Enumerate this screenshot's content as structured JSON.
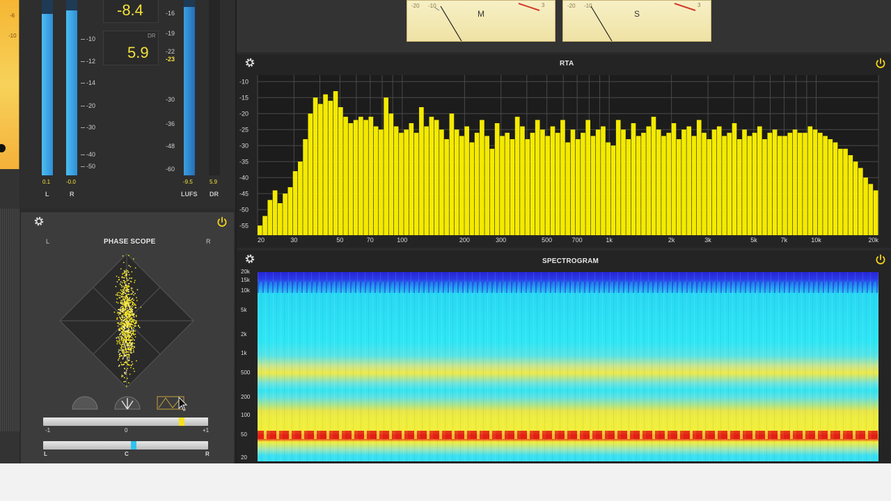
{
  "loudness": {
    "readout_top": "-8.4",
    "dr_label": "DR",
    "dr_value": "5.9",
    "left_scale": [
      "-10",
      "-12",
      "-14",
      "-20",
      "-30",
      "-40",
      "-50"
    ],
    "right_scale": [
      "-16",
      "-19",
      "-22",
      "-23",
      "-30",
      "-36",
      "-48",
      "-60"
    ],
    "peak_L": "0.1",
    "peak_R": "-0.0",
    "lufs_value": "-9.5",
    "dr_small": "5.9",
    "label_L": "L",
    "label_R": "R",
    "label_LUFS": "LUFS",
    "label_DR": "DR",
    "meter_levels": {
      "L": 0.92,
      "R": 0.94,
      "LUFS": 0.96
    }
  },
  "vu": {
    "m_label": "M",
    "s_label": "S",
    "scale": [
      "-20",
      "-10",
      "3"
    ]
  },
  "phase_scope": {
    "title": "PHASE SCOPE",
    "label_L": "L",
    "label_R": "R",
    "corr_scale": [
      "-1",
      "0",
      "+1"
    ],
    "corr_value": 0.68,
    "bal_scale": [
      "L",
      "C",
      "R"
    ],
    "bal_value": 0.1
  },
  "rta": {
    "title": "RTA",
    "y_ticks": [
      "-10",
      "-15",
      "-20",
      "-25",
      "-30",
      "-35",
      "-40",
      "-45",
      "-50",
      "-55"
    ],
    "x_ticks": [
      "20",
      "30",
      "50",
      "70",
      "100",
      "200",
      "300",
      "500",
      "700",
      "1k",
      "2k",
      "3k",
      "5k",
      "7k",
      "10k",
      "20k"
    ]
  },
  "spectrogram": {
    "title": "SPECTROGRAM",
    "y_ticks": [
      "20k",
      "15k",
      "10k",
      "5k",
      "2k",
      "1k",
      "500",
      "200",
      "100",
      "50",
      "20"
    ]
  },
  "colors": {
    "accent_yellow": "#f4ea00",
    "meter_blue": "#3aa6e8",
    "spectro_cyan": "#28e0f0",
    "spectro_blue": "#2a35e0",
    "spectro_red": "#e0201a"
  },
  "chart_data": {
    "type": "bar",
    "x_scale": "log",
    "xlim": [
      20,
      20000
    ],
    "ylim": [
      -58,
      -8
    ],
    "values": [
      -55,
      -52,
      -47,
      -44,
      -48,
      -45,
      -43,
      -38,
      -35,
      -28,
      -20,
      -15,
      -17,
      -14,
      -16,
      -13,
      -18,
      -21,
      -23,
      -22,
      -21,
      -22,
      -21,
      -24,
      -25,
      -15,
      -20,
      -24,
      -26,
      -25,
      -23,
      -26,
      -18,
      -24,
      -21,
      -22,
      -25,
      -28,
      -20,
      -25,
      -27,
      -24,
      -29,
      -26,
      -22,
      -27,
      -31,
      -23,
      -27,
      -26,
      -28,
      -21,
      -24,
      -28,
      -26,
      -22,
      -25,
      -27,
      -24,
      -26,
      -22,
      -29,
      -25,
      -28,
      -26,
      -22,
      -27,
      -25,
      -24,
      -29,
      -30,
      -22,
      -25,
      -28,
      -23,
      -27,
      -26,
      -24,
      -21,
      -25,
      -27,
      -26,
      -23,
      -28,
      -25,
      -24,
      -27,
      -22,
      -26,
      -28,
      -25,
      -24,
      -27,
      -26,
      -23,
      -28,
      -25,
      -27,
      -26,
      -24,
      -28,
      -26,
      -25,
      -27,
      -27,
      -26,
      -25,
      -26,
      -26,
      -24,
      -25,
      -26,
      -27,
      -28,
      -29,
      -31,
      -31,
      -33,
      -35,
      -37,
      -40,
      -42,
      -44
    ]
  }
}
